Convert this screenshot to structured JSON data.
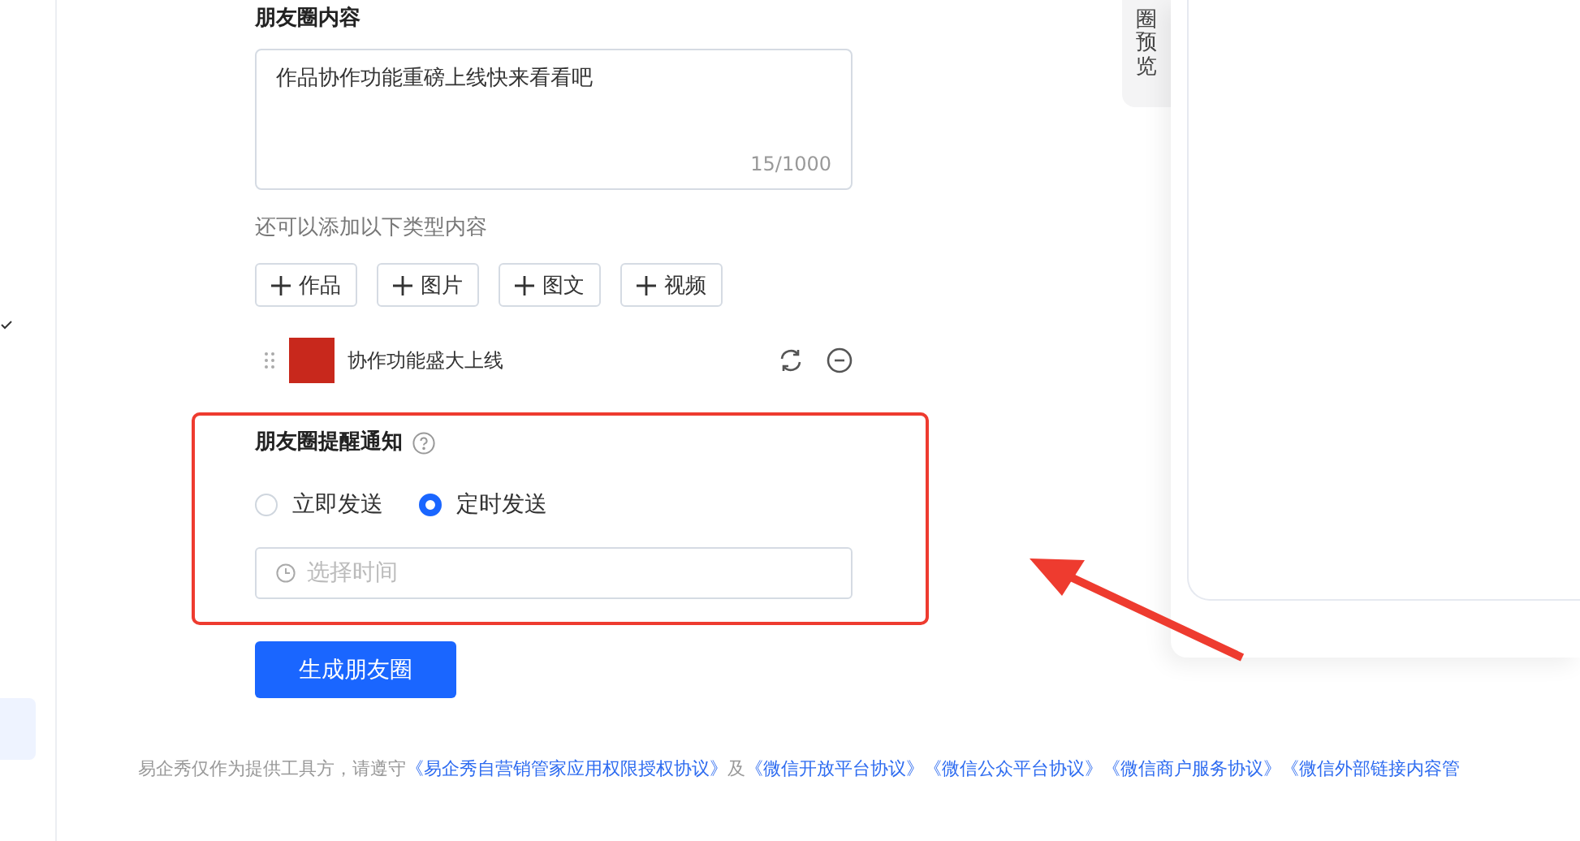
{
  "content": {
    "title": "朋友圈内容",
    "text": "作品协作功能重磅上线快来看看吧",
    "counter": "15/1000"
  },
  "add_hint": "还可以添加以下类型内容",
  "add_buttons": [
    {
      "label": "作品"
    },
    {
      "label": "图片"
    },
    {
      "label": "图文"
    },
    {
      "label": "视频"
    }
  ],
  "attachment": {
    "title": "协作功能盛大上线"
  },
  "reminder": {
    "title": "朋友圈提醒通知",
    "options": [
      {
        "label": "立即发送",
        "selected": false
      },
      {
        "label": "定时发送",
        "selected": true
      }
    ],
    "time_field": {
      "placeholder": "选择时间"
    }
  },
  "submit": "生成朋友圈",
  "preview_tab": "圈预览",
  "footer": [
    {
      "kind": "text",
      "text": "易企秀仅作为提供工具方，请遵守"
    },
    {
      "kind": "link",
      "text": "《易企秀自营销管家应用权限授权协议》"
    },
    {
      "kind": "text",
      "text": "及"
    },
    {
      "kind": "link",
      "text": "《微信开放平台协议》"
    },
    {
      "kind": "link",
      "text": "《微信公众平台协议》"
    },
    {
      "kind": "link",
      "text": "《微信商户服务协议》"
    },
    {
      "kind": "link",
      "text": "《微信外部链接内容管"
    }
  ]
}
